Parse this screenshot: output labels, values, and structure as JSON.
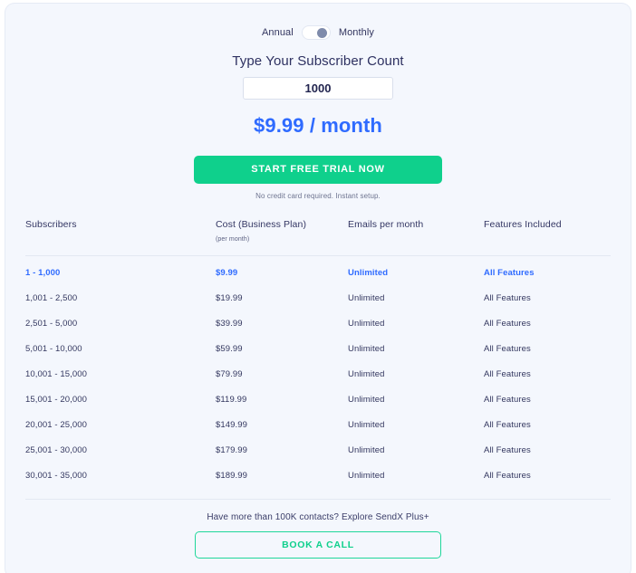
{
  "billing_toggle": {
    "left_label": "Annual",
    "right_label": "Monthly",
    "selected": "Monthly"
  },
  "calculator": {
    "heading": "Type Your Subscriber Count",
    "input_value": "1000",
    "input_placeholder": "Type Your Subscriber Count",
    "price": "$9.99 / month",
    "price_color": "#2f6bff"
  },
  "cta": {
    "label": "START FREE TRIAL NOW",
    "note": "No credit card required. Instant setup.",
    "color": "#0fd08c"
  },
  "table": {
    "headers": {
      "subscribers": "Subscribers",
      "cost": "Cost (Business Plan)",
      "cost_sub": "(per month)",
      "emails": "Emails per month",
      "features": "Features Included"
    },
    "rows": [
      {
        "subscribers": "1 - 1,000",
        "cost": "$9.99",
        "emails": "Unlimited",
        "features": "All Features",
        "active": true
      },
      {
        "subscribers": "1,001 - 2,500",
        "cost": "$19.99",
        "emails": "Unlimited",
        "features": "All Features",
        "active": false
      },
      {
        "subscribers": "2,501 - 5,000",
        "cost": "$39.99",
        "emails": "Unlimited",
        "features": "All Features",
        "active": false
      },
      {
        "subscribers": "5,001 - 10,000",
        "cost": "$59.99",
        "emails": "Unlimited",
        "features": "All Features",
        "active": false
      },
      {
        "subscribers": "10,001 - 15,000",
        "cost": "$79.99",
        "emails": "Unlimited",
        "features": "All Features",
        "active": false
      },
      {
        "subscribers": "15,001 - 20,000",
        "cost": "$119.99",
        "emails": "Unlimited",
        "features": "All Features",
        "active": false
      },
      {
        "subscribers": "20,001 - 25,000",
        "cost": "$149.99",
        "emails": "Unlimited",
        "features": "All Features",
        "active": false
      },
      {
        "subscribers": "25,001 - 30,000",
        "cost": "$179.99",
        "emails": "Unlimited",
        "features": "All Features",
        "active": false
      },
      {
        "subscribers": "30,001 - 35,000",
        "cost": "$189.99",
        "emails": "Unlimited",
        "features": "All Features",
        "active": false
      }
    ]
  },
  "footer": {
    "note": "Have more than 100K contacts? Explore SendX Plus+",
    "button_label": "BOOK A CALL"
  }
}
